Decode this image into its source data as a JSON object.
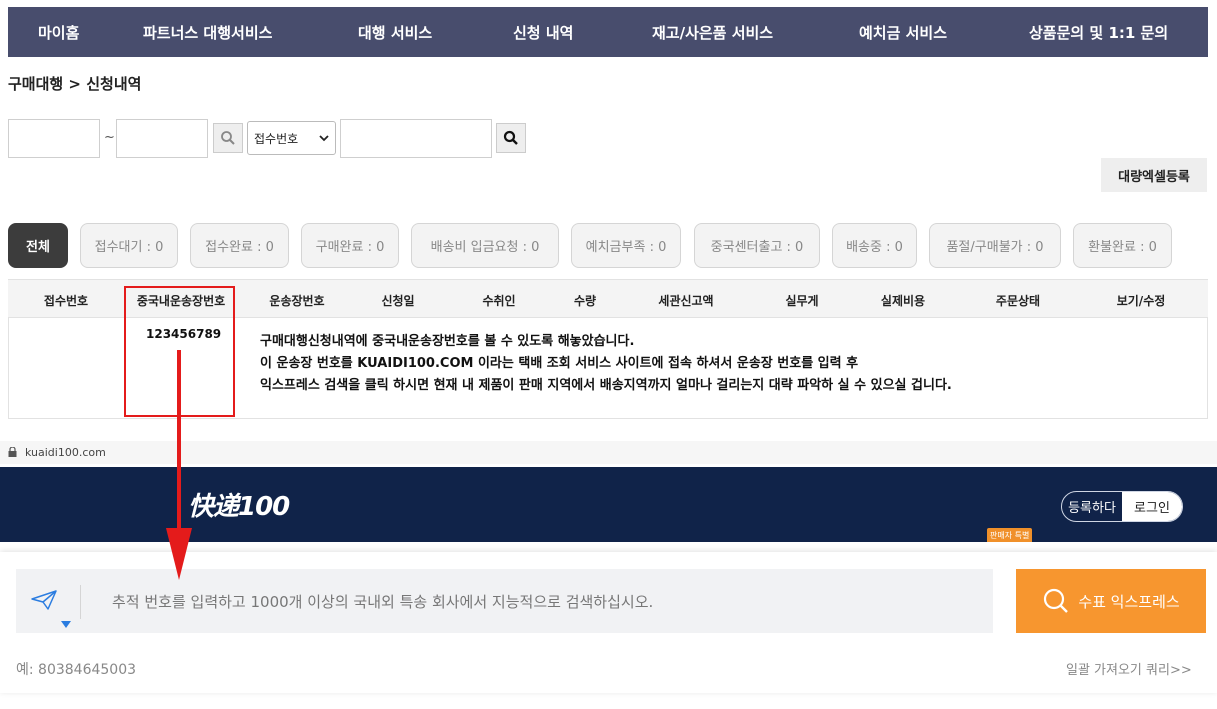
{
  "nav": {
    "items": [
      "마이홈",
      "파트너스 대행서비스",
      "대행 서비스",
      "신청 내역",
      "재고/사은품 서비스",
      "예치금 서비스",
      "상품문의 및 1:1 문의"
    ]
  },
  "breadcrumb": "구매대행 > 신청내역",
  "search": {
    "tilde": "~",
    "select_value": "접수번호"
  },
  "excel_button": "대량엑셀등록",
  "status_chips": [
    "전체",
    "접수대기 : 0",
    "접수완료 : 0",
    "구매완료 : 0",
    "배송비 입금요청 : 0",
    "예치금부족 : 0",
    "중국센터출고 : 0",
    "배송중 : 0",
    "품절/구매불가 : 0",
    "환불완료 : 0"
  ],
  "table": {
    "headers": [
      "접수번호",
      "중국내운송장번호",
      "운송장번호",
      "신청일",
      "수취인",
      "수량",
      "세관신고액",
      "실무게",
      "실제비용",
      "주문상태",
      "보기/수정"
    ],
    "tracking_number": "123456789"
  },
  "annotation": {
    "lines": [
      "구매대행신청내역에 중국내운송장번호를 볼 수 있도록 해놓았습니다.",
      "이 운송장 번호를 KUAIDI100.COM 이라는 택배 조회 서비스 사이트에 접속 하셔서 운송장 번호를 입력 후",
      "익스프레스 검색을 클릭 하시면 현재 내 제품이 판매 지역에서 배송지역까지 얼마나 걸리는지 대략 파악하 실 수 있으실 겁니다."
    ],
    "highlight_color": "#e41b1b"
  },
  "browser": {
    "url": "kuaidi100.com"
  },
  "kuaidi": {
    "logo": "快递100",
    "register": "등록하다",
    "login": "로그인",
    "seller_badge": "판매자 특별",
    "placeholder": "추적 번호를 입력하고 1000개 이상의 국내외 특송 회사에서 지능적으로 검색하십시오.",
    "search_button": "수표 익스프레스",
    "example": "예: 80384645003",
    "batch_query": "일괄 가져오기 쿼리>>",
    "brand_color": "#f7962f",
    "header_color": "#102349"
  }
}
